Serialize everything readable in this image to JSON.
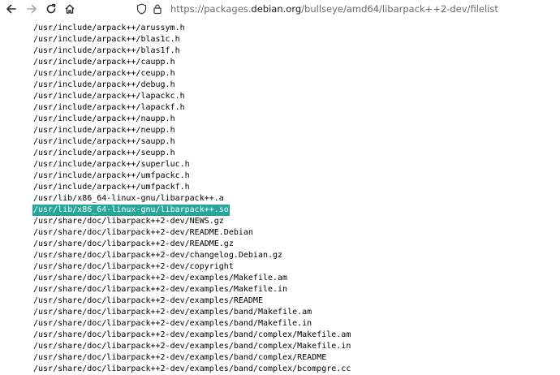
{
  "browser": {
    "url_prefix": "https://packages.",
    "url_host": "debian.org",
    "url_path": "/bullseye/amd64/libarpack++2-dev/filelist"
  },
  "filelist": {
    "selected_index": 16,
    "selection_color": "#26a69a",
    "files": [
      "/usr/include/arpack++/arussym.h",
      "/usr/include/arpack++/blas1c.h",
      "/usr/include/arpack++/blas1f.h",
      "/usr/include/arpack++/caupp.h",
      "/usr/include/arpack++/ceupp.h",
      "/usr/include/arpack++/debug.h",
      "/usr/include/arpack++/lapackc.h",
      "/usr/include/arpack++/lapackf.h",
      "/usr/include/arpack++/naupp.h",
      "/usr/include/arpack++/neupp.h",
      "/usr/include/arpack++/saupp.h",
      "/usr/include/arpack++/seupp.h",
      "/usr/include/arpack++/superluc.h",
      "/usr/include/arpack++/umfpackc.h",
      "/usr/include/arpack++/umfpackf.h",
      "/usr/lib/x86_64-linux-gnu/libarpack++.a",
      "/usr/lib/x86_64-linux-gnu/libarpack++.so",
      "/usr/share/doc/libarpack++2-dev/NEWS.gz",
      "/usr/share/doc/libarpack++2-dev/README.Debian",
      "/usr/share/doc/libarpack++2-dev/README.gz",
      "/usr/share/doc/libarpack++2-dev/changelog.Debian.gz",
      "/usr/share/doc/libarpack++2-dev/copyright",
      "/usr/share/doc/libarpack++2-dev/examples/Makefile.am",
      "/usr/share/doc/libarpack++2-dev/examples/Makefile.in",
      "/usr/share/doc/libarpack++2-dev/examples/README",
      "/usr/share/doc/libarpack++2-dev/examples/band/Makefile.am",
      "/usr/share/doc/libarpack++2-dev/examples/band/Makefile.in",
      "/usr/share/doc/libarpack++2-dev/examples/band/complex/Makefile.am",
      "/usr/share/doc/libarpack++2-dev/examples/band/complex/Makefile.in",
      "/usr/share/doc/libarpack++2-dev/examples/band/complex/README",
      "/usr/share/doc/libarpack++2-dev/examples/band/complex/bcompgre.cc"
    ]
  }
}
